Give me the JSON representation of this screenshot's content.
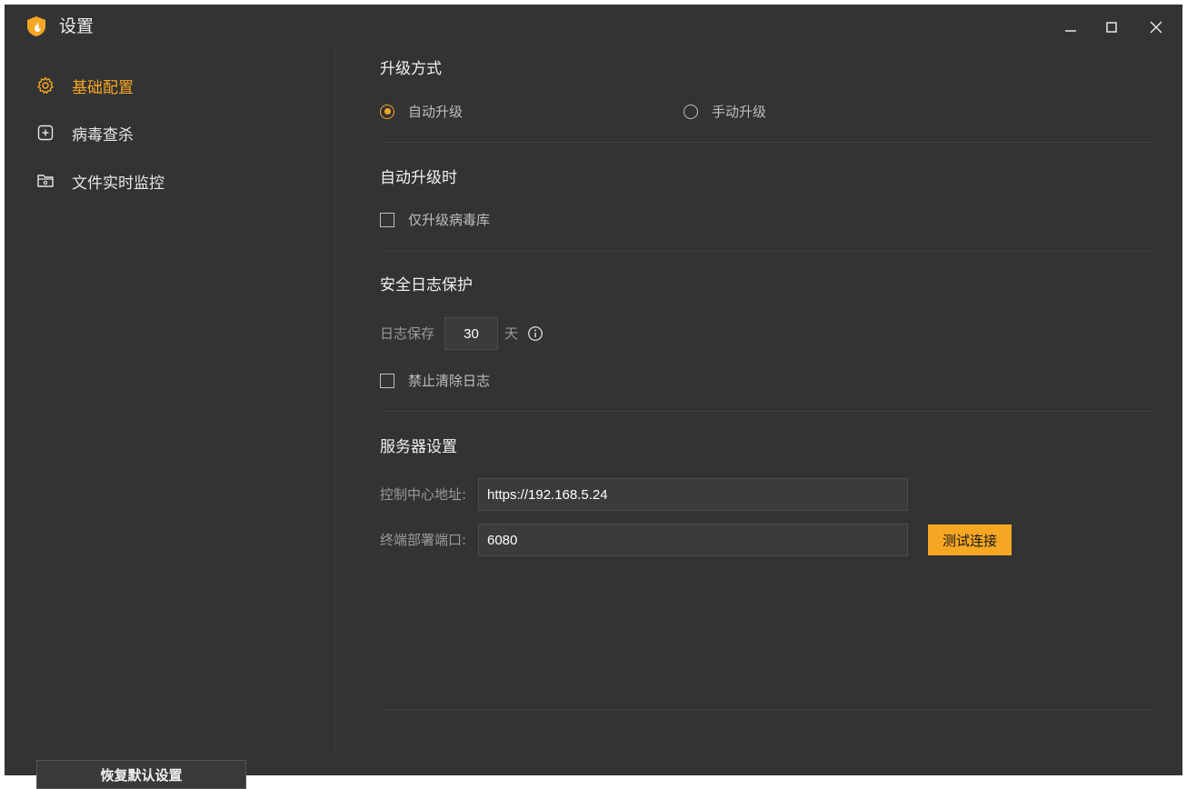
{
  "window": {
    "title": "设置",
    "logo_icon": "shield-flame-icon",
    "controls": {
      "minimize_icon": "minimize-icon",
      "maximize_icon": "maximize-icon",
      "close_icon": "close-icon"
    }
  },
  "sidebar": {
    "items": [
      {
        "label": "基础配置",
        "icon": "gear-icon",
        "active": true
      },
      {
        "label": "病毒查杀",
        "icon": "plus-box-icon",
        "active": false
      },
      {
        "label": "文件实时监控",
        "icon": "folder-icon",
        "active": false
      }
    ],
    "reset_label": "恢复默认设置"
  },
  "main": {
    "upgrade_mode": {
      "title": "升级方式",
      "options": [
        {
          "label": "自动升级",
          "checked": true
        },
        {
          "label": "手动升级",
          "checked": false
        }
      ]
    },
    "auto_upgrade": {
      "title": "自动升级时",
      "checkbox_label": "仅升级病毒库",
      "checked": false
    },
    "log_protection": {
      "title": "安全日志保护",
      "retention_label": "日志保存",
      "retention_value": "30",
      "retention_unit": "天",
      "info_icon": "info-icon",
      "forbid_clear_label": "禁止清除日志",
      "forbid_clear_checked": false
    },
    "server": {
      "title": "服务器设置",
      "control_center_label": "控制中心地址:",
      "control_center_value": "https://192.168.5.24",
      "port_label": "终端部署端口:",
      "port_value": "6080",
      "test_button_label": "测试连接"
    }
  },
  "colors": {
    "accent": "#f5a623",
    "background": "#333333"
  }
}
